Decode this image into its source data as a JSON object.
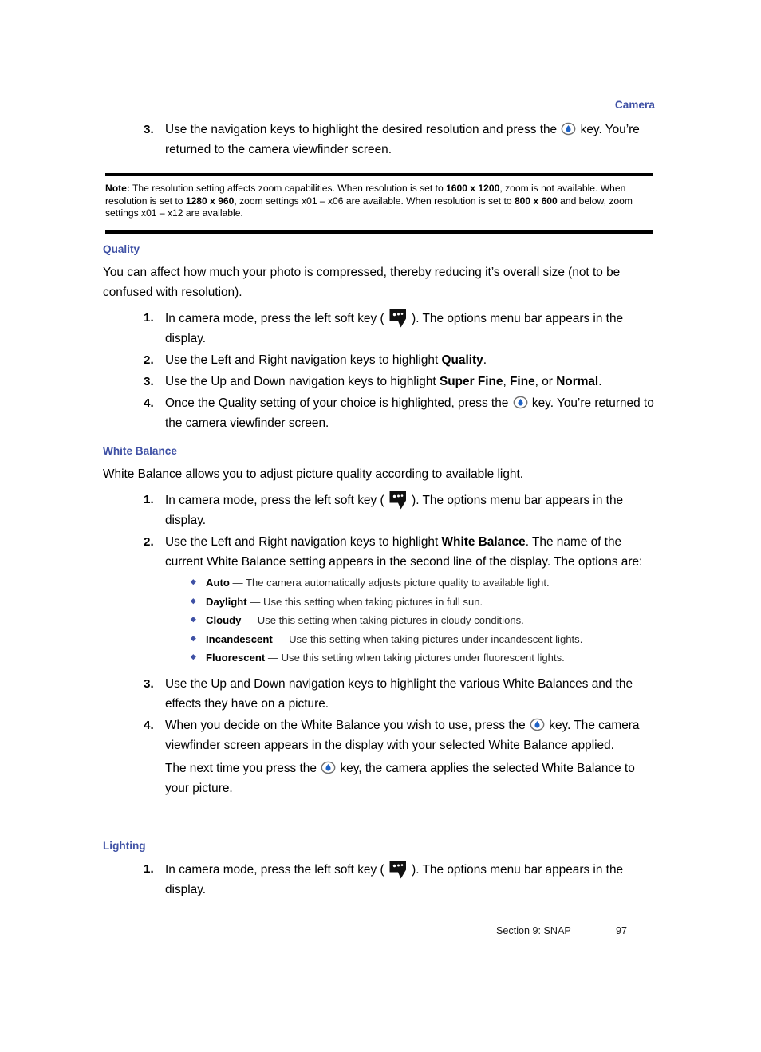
{
  "header": {
    "running_head": "Camera",
    "accent_color": "#3f51a5"
  },
  "top_step": {
    "number": "3.",
    "text_before_icon": "Use the navigation keys to highlight the desired resolution and press the ",
    "icon": "center-select-key-icon",
    "text_after_icon": " key. You’re returned to the camera viewfinder screen."
  },
  "note": {
    "label": "Note:",
    "line1_a": " The resolution setting affects zoom capabilities. When resolution is set to ",
    "res1": "1600 x 1200",
    "line1_b": ", zoom is not available. When resolution is set to ",
    "res2": "1280 x 960",
    "line2_b": ", zoom settings x01 – x06 are available. When resolution is set to ",
    "res3": "800 x 600",
    "line3_b": " and below, zoom settings x01 – x12 are available."
  },
  "quality": {
    "heading": "Quality",
    "intro": "You can affect how much your photo is compressed, thereby reducing it’s overall size (not to be confused with resolution).",
    "steps": [
      {
        "number": "1.",
        "pre": "In camera mode, press the left soft key ( ",
        "icon": "left-soft-key-icon",
        "post": " ). The options menu bar appears in the display."
      },
      {
        "number": "2.",
        "pre": "Use the Left and Right navigation keys to highlight ",
        "bold": "Quality",
        "post": "."
      },
      {
        "number": "3.",
        "pre": "Use the Up and Down navigation keys to highlight ",
        "bold1": "Super Fine",
        "mid1": ", ",
        "bold2": "Fine",
        "mid2": ", or ",
        "bold3": "Normal",
        "post": "."
      },
      {
        "number": "4.",
        "pre": "Once the Quality setting of your choice is highlighted, press the ",
        "icon": "center-select-key-icon",
        "post": " key. You’re returned to the camera viewfinder screen."
      }
    ]
  },
  "white_balance": {
    "heading": "White Balance",
    "intro": "White Balance allows you to adjust picture quality according to available light.",
    "steps": [
      {
        "number": "1.",
        "pre": "In camera mode, press the left soft key ( ",
        "icon": "left-soft-key-icon",
        "post": " ). The options menu bar appears in the display."
      },
      {
        "number": "2.",
        "pre": "Use the Left and Right navigation keys to highlight ",
        "bold": "White Balance",
        "post": ". The name of the current White Balance setting appears in the second line of the display. The options are:"
      },
      {
        "number": "3.",
        "pre": "Use the Up and Down navigation keys to highlight the various White Balances and the effects they have on a picture."
      },
      {
        "number": "4.",
        "pre": "When you decide on the White Balance you wish to use, press the ",
        "icon": "center-select-key-icon",
        "post": " key. The camera viewfinder screen appears in the display with your selected White Balance applied."
      }
    ],
    "options": [
      {
        "term": "Auto",
        "dash": " — ",
        "desc": "The camera automatically adjusts picture quality to available light."
      },
      {
        "term": "Daylight",
        "dash": " — ",
        "desc": "Use this setting when taking pictures in full sun."
      },
      {
        "term": "Cloudy",
        "dash": " — ",
        "desc": "Use this setting when taking pictures in cloudy conditions."
      },
      {
        "term": "Incandescent",
        "dash": " — ",
        "desc": "Use this setting when taking pictures under incandescent lights."
      },
      {
        "term": "Fluorescent",
        "dash": " — ",
        "desc": "Use this setting when taking pictures under fluorescent lights."
      }
    ],
    "trailing": {
      "pre": "The next time you press the ",
      "icon": "center-select-key-icon",
      "post": " key, the camera applies the selected White Balance to your picture."
    }
  },
  "lighting": {
    "heading": "Lighting",
    "steps": [
      {
        "number": "1.",
        "pre": "In camera mode, press the left soft key ( ",
        "icon": "left-soft-key-icon",
        "post": " ). The options menu bar appears in the display."
      }
    ]
  },
  "footer": {
    "section": "Section 9: SNAP",
    "page_number": "97"
  }
}
